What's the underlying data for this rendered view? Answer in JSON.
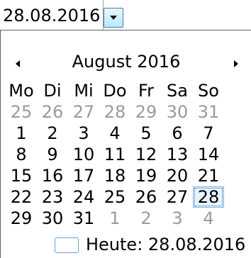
{
  "date_field": {
    "value": "28.08.2016"
  },
  "calendar": {
    "month_title": "August 2016",
    "weekdays": [
      "Mo",
      "Di",
      "Mi",
      "Do",
      "Fr",
      "Sa",
      "So"
    ],
    "weeks": [
      [
        {
          "d": "25",
          "other": true
        },
        {
          "d": "26",
          "other": true
        },
        {
          "d": "27",
          "other": true
        },
        {
          "d": "28",
          "other": true
        },
        {
          "d": "29",
          "other": true
        },
        {
          "d": "30",
          "other": true
        },
        {
          "d": "31",
          "other": true
        }
      ],
      [
        {
          "d": "1"
        },
        {
          "d": "2"
        },
        {
          "d": "3"
        },
        {
          "d": "4"
        },
        {
          "d": "5"
        },
        {
          "d": "6"
        },
        {
          "d": "7"
        }
      ],
      [
        {
          "d": "8"
        },
        {
          "d": "9"
        },
        {
          "d": "10"
        },
        {
          "d": "11"
        },
        {
          "d": "12"
        },
        {
          "d": "13"
        },
        {
          "d": "14"
        }
      ],
      [
        {
          "d": "15"
        },
        {
          "d": "16"
        },
        {
          "d": "17"
        },
        {
          "d": "18"
        },
        {
          "d": "19"
        },
        {
          "d": "20"
        },
        {
          "d": "21"
        }
      ],
      [
        {
          "d": "22"
        },
        {
          "d": "23"
        },
        {
          "d": "24"
        },
        {
          "d": "25"
        },
        {
          "d": "26"
        },
        {
          "d": "27"
        },
        {
          "d": "28",
          "selected": true
        }
      ],
      [
        {
          "d": "29"
        },
        {
          "d": "30"
        },
        {
          "d": "31"
        },
        {
          "d": "1",
          "other": true
        },
        {
          "d": "2",
          "other": true
        },
        {
          "d": "3",
          "other": true
        },
        {
          "d": "4",
          "other": true
        }
      ]
    ],
    "today_label": "Heute: 28.08.2016"
  },
  "icons": {
    "dropdown": "chevron-down-icon",
    "prev": "triangle-left-icon",
    "next": "triangle-right-icon"
  },
  "colors": {
    "selected_bg": "#e9f3fb",
    "selected_border": "#7ab6e4",
    "other_month_text": "#9a9a9a"
  }
}
